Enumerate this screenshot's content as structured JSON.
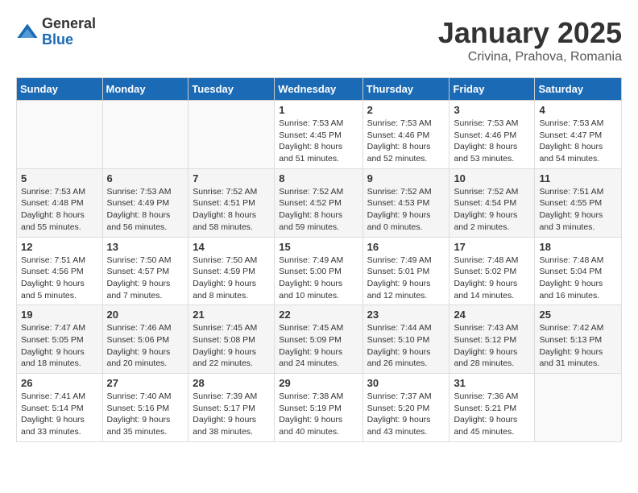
{
  "logo": {
    "general": "General",
    "blue": "Blue"
  },
  "title": "January 2025",
  "subtitle": "Crivina, Prahova, Romania",
  "headers": [
    "Sunday",
    "Monday",
    "Tuesday",
    "Wednesday",
    "Thursday",
    "Friday",
    "Saturday"
  ],
  "weeks": [
    [
      {
        "day": "",
        "info": ""
      },
      {
        "day": "",
        "info": ""
      },
      {
        "day": "",
        "info": ""
      },
      {
        "day": "1",
        "info": "Sunrise: 7:53 AM\nSunset: 4:45 PM\nDaylight: 8 hours and 51 minutes."
      },
      {
        "day": "2",
        "info": "Sunrise: 7:53 AM\nSunset: 4:46 PM\nDaylight: 8 hours and 52 minutes."
      },
      {
        "day": "3",
        "info": "Sunrise: 7:53 AM\nSunset: 4:46 PM\nDaylight: 8 hours and 53 minutes."
      },
      {
        "day": "4",
        "info": "Sunrise: 7:53 AM\nSunset: 4:47 PM\nDaylight: 8 hours and 54 minutes."
      }
    ],
    [
      {
        "day": "5",
        "info": "Sunrise: 7:53 AM\nSunset: 4:48 PM\nDaylight: 8 hours and 55 minutes."
      },
      {
        "day": "6",
        "info": "Sunrise: 7:53 AM\nSunset: 4:49 PM\nDaylight: 8 hours and 56 minutes."
      },
      {
        "day": "7",
        "info": "Sunrise: 7:52 AM\nSunset: 4:51 PM\nDaylight: 8 hours and 58 minutes."
      },
      {
        "day": "8",
        "info": "Sunrise: 7:52 AM\nSunset: 4:52 PM\nDaylight: 8 hours and 59 minutes."
      },
      {
        "day": "9",
        "info": "Sunrise: 7:52 AM\nSunset: 4:53 PM\nDaylight: 9 hours and 0 minutes."
      },
      {
        "day": "10",
        "info": "Sunrise: 7:52 AM\nSunset: 4:54 PM\nDaylight: 9 hours and 2 minutes."
      },
      {
        "day": "11",
        "info": "Sunrise: 7:51 AM\nSunset: 4:55 PM\nDaylight: 9 hours and 3 minutes."
      }
    ],
    [
      {
        "day": "12",
        "info": "Sunrise: 7:51 AM\nSunset: 4:56 PM\nDaylight: 9 hours and 5 minutes."
      },
      {
        "day": "13",
        "info": "Sunrise: 7:50 AM\nSunset: 4:57 PM\nDaylight: 9 hours and 7 minutes."
      },
      {
        "day": "14",
        "info": "Sunrise: 7:50 AM\nSunset: 4:59 PM\nDaylight: 9 hours and 8 minutes."
      },
      {
        "day": "15",
        "info": "Sunrise: 7:49 AM\nSunset: 5:00 PM\nDaylight: 9 hours and 10 minutes."
      },
      {
        "day": "16",
        "info": "Sunrise: 7:49 AM\nSunset: 5:01 PM\nDaylight: 9 hours and 12 minutes."
      },
      {
        "day": "17",
        "info": "Sunrise: 7:48 AM\nSunset: 5:02 PM\nDaylight: 9 hours and 14 minutes."
      },
      {
        "day": "18",
        "info": "Sunrise: 7:48 AM\nSunset: 5:04 PM\nDaylight: 9 hours and 16 minutes."
      }
    ],
    [
      {
        "day": "19",
        "info": "Sunrise: 7:47 AM\nSunset: 5:05 PM\nDaylight: 9 hours and 18 minutes."
      },
      {
        "day": "20",
        "info": "Sunrise: 7:46 AM\nSunset: 5:06 PM\nDaylight: 9 hours and 20 minutes."
      },
      {
        "day": "21",
        "info": "Sunrise: 7:45 AM\nSunset: 5:08 PM\nDaylight: 9 hours and 22 minutes."
      },
      {
        "day": "22",
        "info": "Sunrise: 7:45 AM\nSunset: 5:09 PM\nDaylight: 9 hours and 24 minutes."
      },
      {
        "day": "23",
        "info": "Sunrise: 7:44 AM\nSunset: 5:10 PM\nDaylight: 9 hours and 26 minutes."
      },
      {
        "day": "24",
        "info": "Sunrise: 7:43 AM\nSunset: 5:12 PM\nDaylight: 9 hours and 28 minutes."
      },
      {
        "day": "25",
        "info": "Sunrise: 7:42 AM\nSunset: 5:13 PM\nDaylight: 9 hours and 31 minutes."
      }
    ],
    [
      {
        "day": "26",
        "info": "Sunrise: 7:41 AM\nSunset: 5:14 PM\nDaylight: 9 hours and 33 minutes."
      },
      {
        "day": "27",
        "info": "Sunrise: 7:40 AM\nSunset: 5:16 PM\nDaylight: 9 hours and 35 minutes."
      },
      {
        "day": "28",
        "info": "Sunrise: 7:39 AM\nSunset: 5:17 PM\nDaylight: 9 hours and 38 minutes."
      },
      {
        "day": "29",
        "info": "Sunrise: 7:38 AM\nSunset: 5:19 PM\nDaylight: 9 hours and 40 minutes."
      },
      {
        "day": "30",
        "info": "Sunrise: 7:37 AM\nSunset: 5:20 PM\nDaylight: 9 hours and 43 minutes."
      },
      {
        "day": "31",
        "info": "Sunrise: 7:36 AM\nSunset: 5:21 PM\nDaylight: 9 hours and 45 minutes."
      },
      {
        "day": "",
        "info": ""
      }
    ]
  ]
}
